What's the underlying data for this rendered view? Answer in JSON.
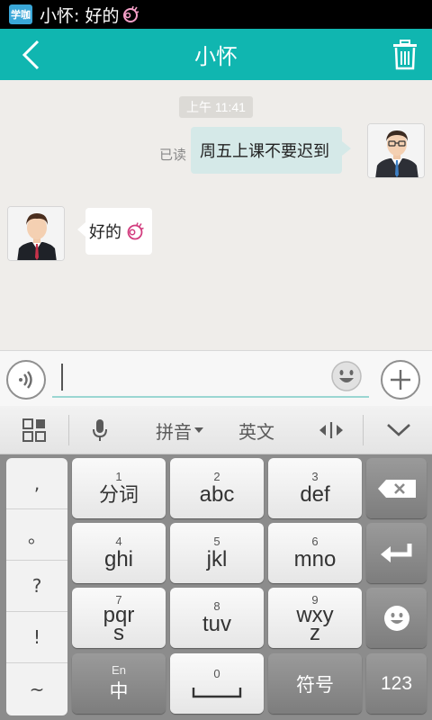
{
  "status_bar": {
    "app_logo_text": "学咖",
    "notification_text": "小怀: 好的"
  },
  "header": {
    "title": "小怀",
    "accent_color": "#10b6b0"
  },
  "chat": {
    "timestamp": "上午 11:41",
    "messages": [
      {
        "side": "right",
        "text": "周五上课不要迟到",
        "read_status": "已读"
      },
      {
        "side": "left",
        "text": "好的"
      }
    ]
  },
  "input_bar": {
    "value": ""
  },
  "keyboard_toolbar": {
    "pinyin_label": "拼音",
    "english_label": "英文"
  },
  "keyboard": {
    "side_symbols": [
      ",",
      "。",
      "?",
      "!",
      "~"
    ],
    "keys": {
      "k1": {
        "num": "1",
        "label": "分词"
      },
      "k2": {
        "num": "2",
        "label": "abc"
      },
      "k3": {
        "num": "3",
        "label": "def"
      },
      "k4": {
        "num": "4",
        "label": "ghi"
      },
      "k5": {
        "num": "5",
        "label": "jkl"
      },
      "k6": {
        "num": "6",
        "label": "mno"
      },
      "k7": {
        "num": "7",
        "label_line1": "pqr",
        "label_line2": "s"
      },
      "k8": {
        "num": "8",
        "label": "tuv"
      },
      "k9": {
        "num": "9",
        "label_line1": "wxy",
        "label_line2": "z"
      },
      "k0": {
        "num": "0"
      },
      "lang": {
        "small": "En",
        "label": "中"
      },
      "symbols": {
        "label": "符号"
      },
      "numbers": {
        "label": "123"
      }
    }
  }
}
